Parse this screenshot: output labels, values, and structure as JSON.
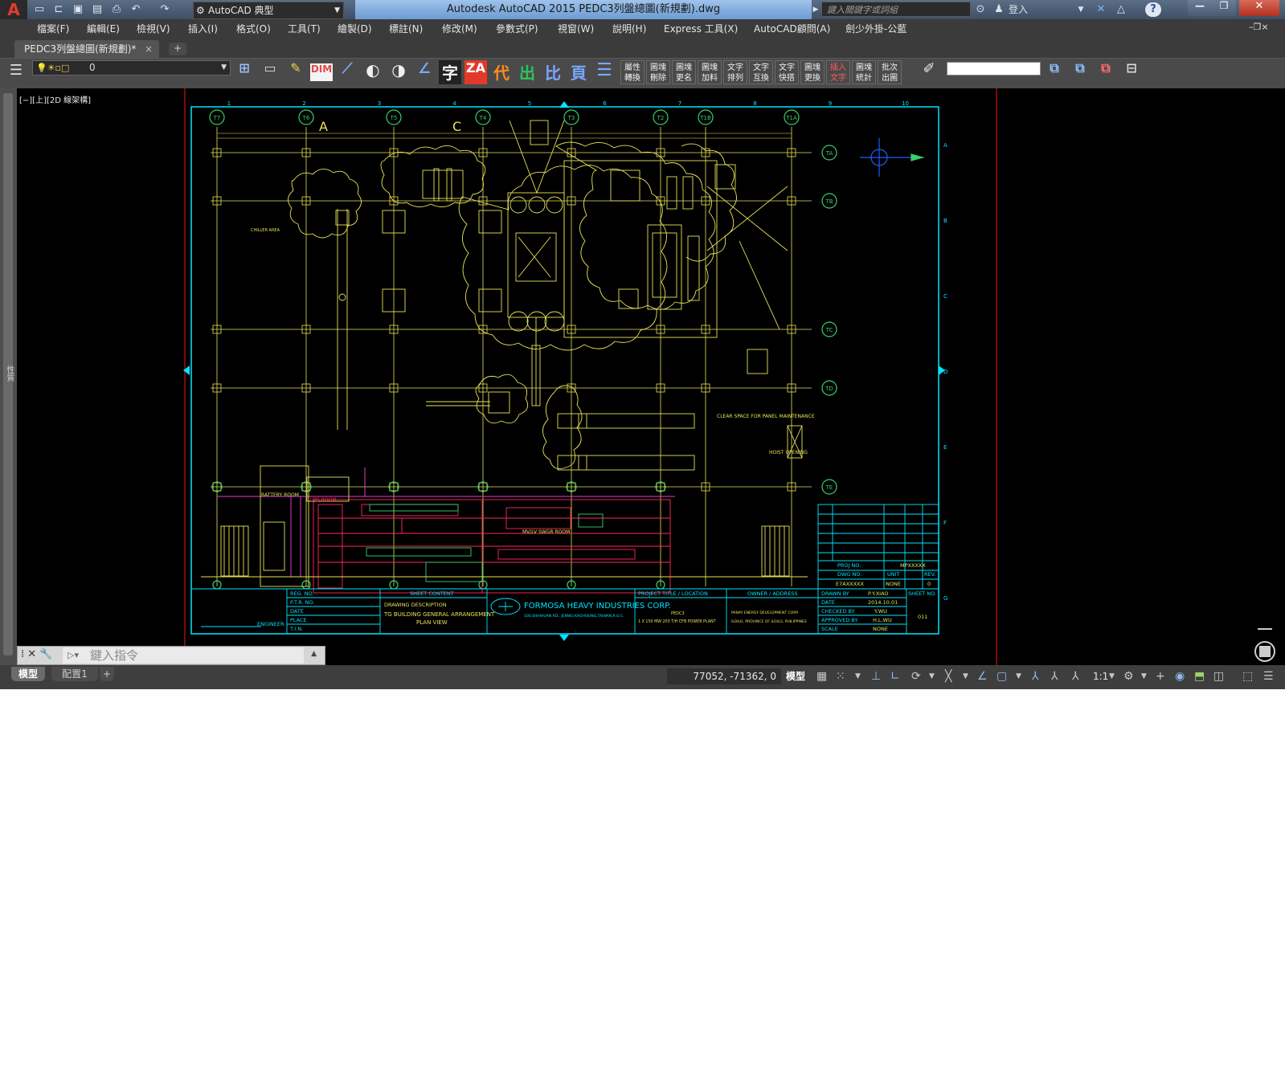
{
  "app": {
    "window_title": "Autodesk AutoCAD 2015    PEDC3列盤總圖(新規劃).dwg",
    "workspace": "AutoCAD 典型",
    "search_placeholder": "鍵入關鍵字或詞組",
    "login": "登入",
    "help_icon": "?"
  },
  "menu": [
    "檔案(F)",
    "編輯(E)",
    "檢視(V)",
    "插入(I)",
    "格式(O)",
    "工具(T)",
    "繪製(D)",
    "標註(N)",
    "修改(M)",
    "參數式(P)",
    "視窗(W)",
    "說明(H)",
    "Express 工具(X)",
    "AutoCAD顧問(A)",
    "劍少外掛-公藍"
  ],
  "document_tab": {
    "name": "PEDC3列盤總圖(新規劃)*",
    "close": "×",
    "new": "+"
  },
  "layer": {
    "current": "0"
  },
  "toolbar_glyphs": {
    "dim": "DIM",
    "char": "字",
    "za": "ZA",
    "dai": "代",
    "chu": "出",
    "bi": "比",
    "ye": "頁"
  },
  "toolbar_text_buttons": [
    "屬性\n轉換",
    "圖塊\n刪除",
    "圖塊\n更名",
    "圖塊\n加料",
    "文字\n排列",
    "文字\n互換",
    "文字\n快搭",
    "圖塊\n更換",
    "插入\n文字",
    "圖塊\n統計",
    "批次\n出圖"
  ],
  "viewport_label": "[−][上][2D 線架構]",
  "left_panel_label": "性質",
  "command": {
    "placeholder": "鍵入指令"
  },
  "layout_tabs": [
    "模型",
    "配置1",
    "+"
  ],
  "status": {
    "coords": "77052, -71362, 0",
    "model": "模型",
    "scale": "1:1"
  },
  "drawing": {
    "grid_top": [
      "T7",
      "T6",
      "T5",
      "T4",
      "T3",
      "T2",
      "T1B",
      "T1A"
    ],
    "grid_right": [
      "TA",
      "TB",
      "TC",
      "TD",
      "TE"
    ],
    "column_numbers": [
      "1",
      "2",
      "3",
      "4",
      "5",
      "6",
      "7",
      "8",
      "9",
      "10"
    ],
    "side_letters": [
      "A",
      "B",
      "C",
      "D",
      "E",
      "F",
      "G"
    ],
    "section_marks": [
      "A",
      "C"
    ],
    "labels": {
      "battery_room": "BATTERY ROOM",
      "ups_room": "UPS ROOM",
      "swgr_room": "MV/LV SWGR ROOM",
      "clear_space": "CLEAR SPACE FOR PANEL MAINTENANCE",
      "hoist": "HOIST OPENING",
      "chiller": "CHILLER AREA",
      "pre_label": "PEDC3"
    },
    "title_block": {
      "reg_no": "REG. NO. :",
      "ptr_no": "P.T.R. NO.",
      "date": "DATE",
      "place": "PLACE",
      "tin": "T.I.N.",
      "engineer": "ENGINEER",
      "sheet_content": "SHEET CONTENT",
      "drawing_description": "DRAWING DESCRIPTION",
      "desc_1": "TG BUILDING GENERAL ARRANGEMENT",
      "desc_2": "PLAN VIEW",
      "company": "FORMOSA HEAVY INDUSTRIES CORP.",
      "company_addr": "100,SHIHHUAN RD., JENWU,KAOHSIUNG,TAIWAN,R.O.C.",
      "project_title": "PROJECT TITLE / LOCATION",
      "project_name": "PEDC3",
      "project_line": "1 X 150 MW 203 T/H CFB POWER PLANT",
      "owner": "OWNER / ADDRESS",
      "owner_name": "PANAY ENERGY DEVELOPMENT CORP.",
      "owner_addr": "ILOILO, PROVINCE OF ILOILO, PHILIPPINES",
      "drawn_by_label": "DRAWN BY",
      "drawn_by": "P.Y.XIAO",
      "date_label": "DATE",
      "date_val": "2014.10.01",
      "checked_label": "CHECKED BY",
      "checked": "Y.WU",
      "approved_label": "APPROVED BY",
      "approved": "H.L.WU",
      "scale_label": "SCALE",
      "scale": "NONE",
      "proj_no_label": "PROJ NO.",
      "proj_no": "MPXXXXX",
      "dwg_no_label": "DWG NO.",
      "dwg_no": "E7AXXXXX",
      "unit_label": "UNIT",
      "unit": "NONE",
      "rev_label": "REV.",
      "rev": "0",
      "sheet_no_label": "SHEET NO.",
      "sheet_no": "011"
    }
  },
  "colors": {
    "cad_bg": "#000000",
    "border": "#00e5ff",
    "grid": "#e8e25a",
    "equipment": "#ff2a5a",
    "green": "#34d36b",
    "magenta": "#e23cc8",
    "red_line": "#cc1111"
  }
}
